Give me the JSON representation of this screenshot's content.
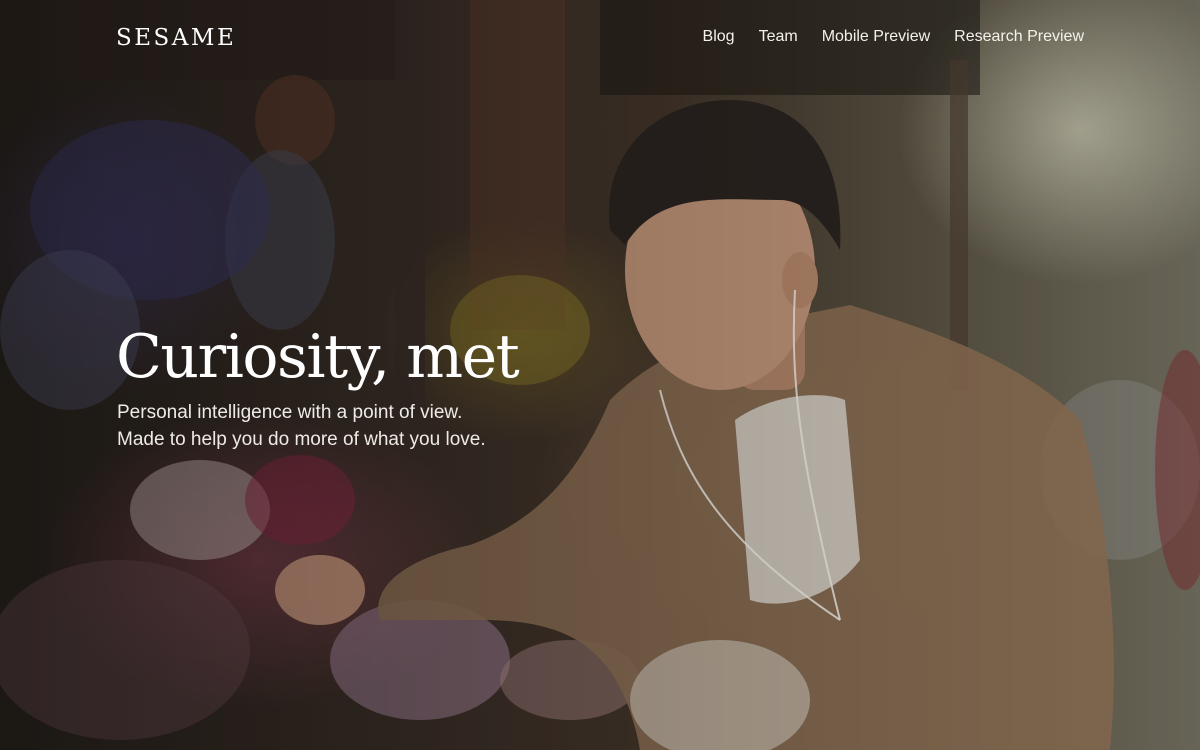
{
  "brand": {
    "logo_text": "SESAME"
  },
  "nav": {
    "links": [
      {
        "label": "Blog"
      },
      {
        "label": "Team"
      },
      {
        "label": "Mobile Preview"
      },
      {
        "label": "Research Preview"
      }
    ]
  },
  "hero": {
    "headline": "Curiosity, met",
    "subline_lines": [
      "Personal intelligence with a point of view.",
      "Made to help you do more of what you love."
    ],
    "background_image": "photo of a man wearing earphones browsing flowers at a street florist"
  },
  "colors": {
    "text_primary": "#ffffff",
    "text_secondary": "#eeeae5"
  }
}
